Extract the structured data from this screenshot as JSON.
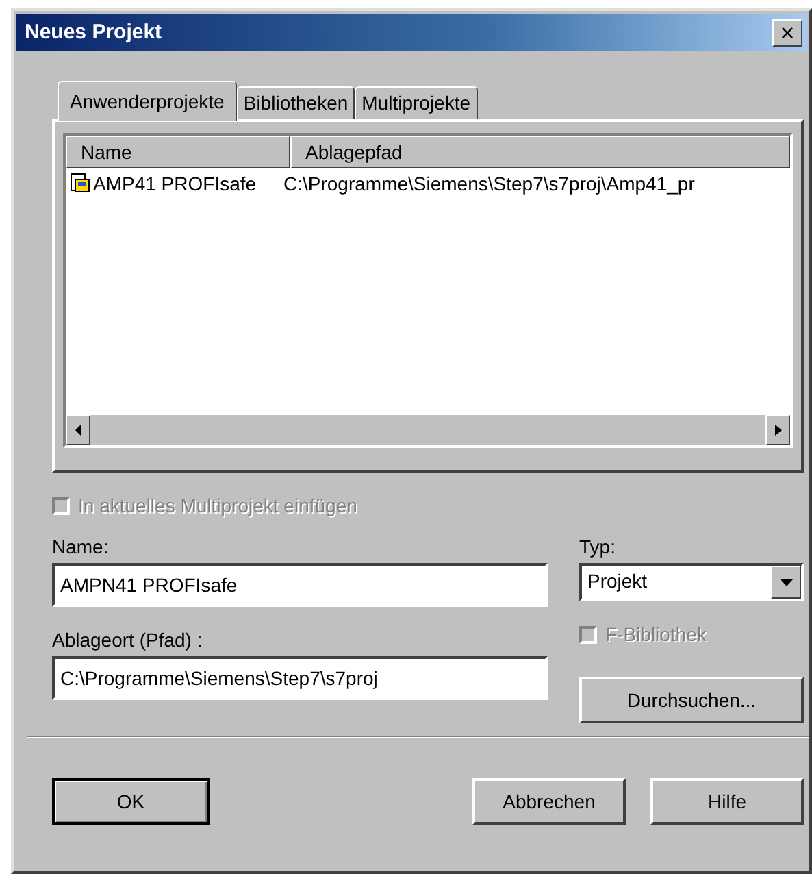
{
  "window": {
    "title": "Neues Projekt",
    "close": "×"
  },
  "tabs": [
    {
      "label": "Anwenderprojekte",
      "selected": true
    },
    {
      "label": "Bibliotheken",
      "selected": false
    },
    {
      "label": "Multiprojekte",
      "selected": false
    }
  ],
  "table": {
    "columns": [
      "Name",
      "Ablagepfad"
    ],
    "rows": [
      {
        "name": "AMP41 PROFIsafe",
        "path": "C:\\Programme\\Siemens\\Step7\\s7proj\\Amp41_pr",
        "selected": false
      }
    ]
  },
  "insert_checkbox": {
    "label": "In aktuelles Multiprojekt einfügen",
    "checked": false,
    "disabled": true
  },
  "name_field": {
    "label": "Name:",
    "value": "AMPN41 PROFIsafe"
  },
  "type_field": {
    "label": "Typ:",
    "value": "Projekt"
  },
  "library_checkbox": {
    "label": "F-Bibliothek",
    "checked": false,
    "disabled": true
  },
  "location_field": {
    "label": "Ablageort (Pfad) :",
    "value": "C:\\Programme\\Siemens\\Step7\\s7proj"
  },
  "browse_button": "Durchsuchen...",
  "buttons": [
    "OK",
    "Abbrechen",
    "Hilfe"
  ]
}
